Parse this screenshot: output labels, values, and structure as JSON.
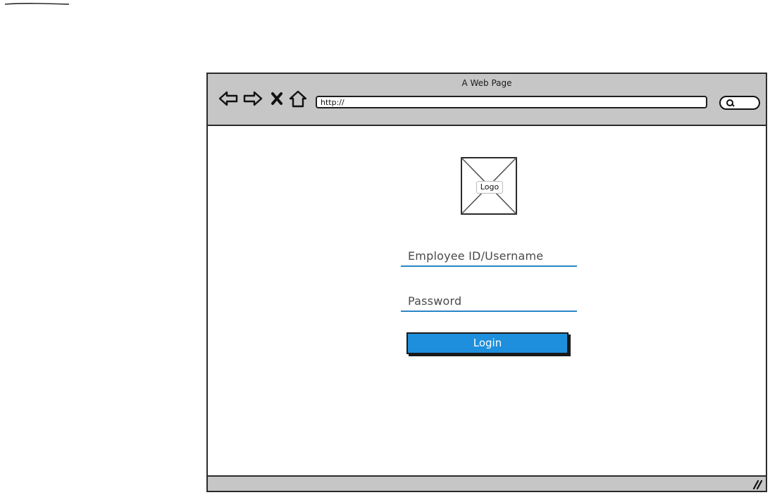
{
  "window": {
    "title": "A Web Page"
  },
  "toolbar": {
    "back_icon": "back-arrow-icon",
    "forward_icon": "forward-arrow-icon",
    "stop_icon": "close-icon",
    "home_icon": "home-icon",
    "search_icon": "search-icon"
  },
  "address_bar": {
    "value": "http://"
  },
  "logo": {
    "label": "Logo"
  },
  "login_form": {
    "username_placeholder": "Employee ID/Username",
    "password_placeholder": "Password",
    "login_label": "Login"
  },
  "colors": {
    "chrome": "#c6c6c6",
    "accent": "#1d8fdc",
    "underline": "#2a86c7"
  }
}
